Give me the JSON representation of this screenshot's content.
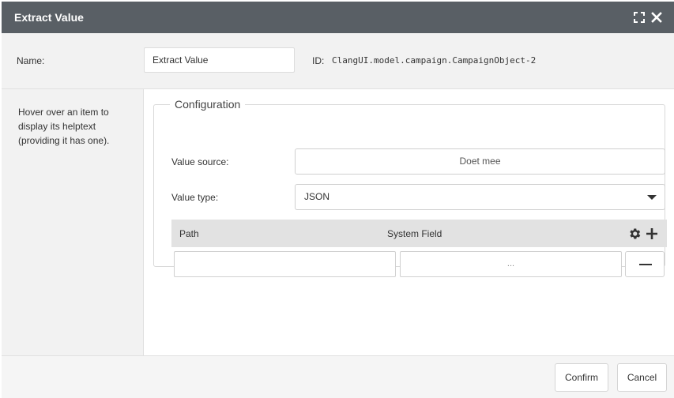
{
  "dialog": {
    "title": "Extract Value",
    "icons": [
      "fullscreen-icon",
      "close-icon"
    ]
  },
  "name_bar": {
    "name_label": "Name:",
    "name_value": "Extract Value",
    "id_label": "ID:",
    "id_value": "ClangUI.model.campaign.CampaignObject-2"
  },
  "help": {
    "text": "Hover over an item to display its helptext (providing it has one)."
  },
  "configuration": {
    "legend": "Configuration",
    "value_source_label": "Value source:",
    "value_source_value": "Doet mee",
    "value_type_label": "Value type:",
    "value_type_selected": "JSON",
    "table": {
      "columns": [
        "Path",
        "System Field"
      ],
      "header_icons": [
        "gear-icon",
        "plus-icon"
      ],
      "rows": [
        {
          "path": "",
          "system_field": "..."
        }
      ]
    }
  },
  "footer": {
    "confirm_label": "Confirm",
    "cancel_label": "Cancel"
  }
}
